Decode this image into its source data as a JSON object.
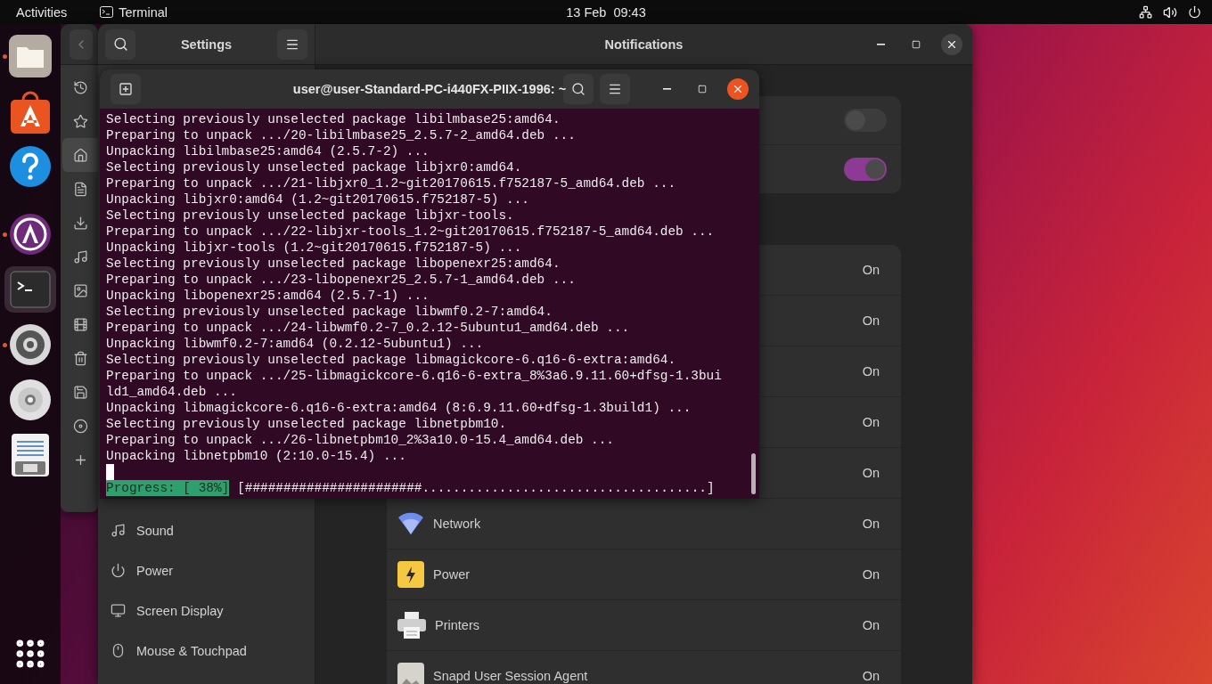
{
  "top_bar": {
    "activities": "Activities",
    "app_name": "Terminal",
    "clock": "13 Feb  09:43"
  },
  "dock": [
    {
      "kind": "files",
      "running": true,
      "active": false
    },
    {
      "kind": "store",
      "running": false,
      "active": false
    },
    {
      "kind": "help",
      "running": false,
      "active": false
    },
    {
      "kind": "updater",
      "running": true,
      "active": false
    },
    {
      "kind": "terminal",
      "running": false,
      "active": true
    },
    {
      "kind": "settings",
      "running": true,
      "active": false
    },
    {
      "kind": "disc",
      "running": false,
      "active": false
    },
    {
      "kind": "editor",
      "running": false,
      "active": false
    }
  ],
  "files_window": {
    "sidebar": [
      {
        "kind": "recent",
        "selected": false
      },
      {
        "kind": "starred",
        "selected": false
      },
      {
        "kind": "home",
        "selected": true
      },
      {
        "kind": "documents",
        "selected": false
      },
      {
        "kind": "downloads",
        "selected": false
      },
      {
        "kind": "music",
        "selected": false
      },
      {
        "kind": "pictures",
        "selected": false
      },
      {
        "kind": "videos",
        "selected": false
      },
      {
        "kind": "trash",
        "selected": false
      },
      {
        "kind": "floppy",
        "selected": false
      },
      {
        "kind": "disc",
        "selected": false
      },
      {
        "kind": "add",
        "selected": false
      }
    ]
  },
  "settings_window": {
    "title": "Settings",
    "panel_title": "Notifications",
    "sidebar": [
      {
        "kind": "sound",
        "label": "Sound"
      },
      {
        "kind": "power",
        "label": "Power"
      },
      {
        "kind": "display",
        "label": "Screen Display"
      },
      {
        "kind": "mouse",
        "label": "Mouse & Touchpad"
      }
    ],
    "toggles": [
      {
        "on": false
      },
      {
        "on": true
      }
    ],
    "apps": [
      {
        "status": "On"
      },
      {
        "status": "On"
      },
      {
        "status": "On"
      },
      {
        "status": "On"
      },
      {
        "status": "On"
      },
      {
        "kind": "network",
        "name": "Network",
        "status": "On"
      },
      {
        "kind": "power",
        "name": "Power",
        "status": "On"
      },
      {
        "kind": "printers",
        "name": "Printers",
        "status": "On"
      },
      {
        "kind": "snapd",
        "name": "Snapd User Session Agent",
        "status": "On"
      }
    ]
  },
  "terminal": {
    "title": "user@user-Standard-PC-i440FX-PIIX-1996: ~",
    "lines": [
      "Selecting previously unselected package libilmbase25:amd64.",
      "Preparing to unpack .../20-libilmbase25_2.5.7-2_amd64.deb ...",
      "Unpacking libilmbase25:amd64 (2.5.7-2) ...",
      "Selecting previously unselected package libjxr0:amd64.",
      "Preparing to unpack .../21-libjxr0_1.2~git20170615.f752187-5_amd64.deb ...",
      "Unpacking libjxr0:amd64 (1.2~git20170615.f752187-5) ...",
      "Selecting previously unselected package libjxr-tools.",
      "Preparing to unpack .../22-libjxr-tools_1.2~git20170615.f752187-5_amd64.deb ...",
      "Unpacking libjxr-tools (1.2~git20170615.f752187-5) ...",
      "Selecting previously unselected package libopenexr25:amd64.",
      "Preparing to unpack .../23-libopenexr25_2.5.7-1_amd64.deb ...",
      "Unpacking libopenexr25:amd64 (2.5.7-1) ...",
      "Selecting previously unselected package libwmf0.2-7:amd64.",
      "Preparing to unpack .../24-libwmf0.2-7_0.2.12-5ubuntu1_amd64.deb ...",
      "Unpacking libwmf0.2-7:amd64 (0.2.12-5ubuntu1) ...",
      "Selecting previously unselected package libmagickcore-6.q16-6-extra:amd64.",
      "Preparing to unpack .../25-libmagickcore-6.q16-6-extra_8%3a6.9.11.60+dfsg-1.3bui",
      "ld1_amd64.deb ...",
      "Unpacking libmagickcore-6.q16-6-extra:amd64 (8:6.9.11.60+dfsg-1.3build1) ...",
      "Selecting previously unselected package libnetpbm10.",
      "Preparing to unpack .../26-libnetpbm10_2%3a10.0-15.4_amd64.deb ...",
      "Unpacking libnetpbm10 (2:10.0-15.4) ..."
    ],
    "progress": {
      "label": "Progress: [ 38%]",
      "bar": "[#######################.....................................]"
    }
  }
}
